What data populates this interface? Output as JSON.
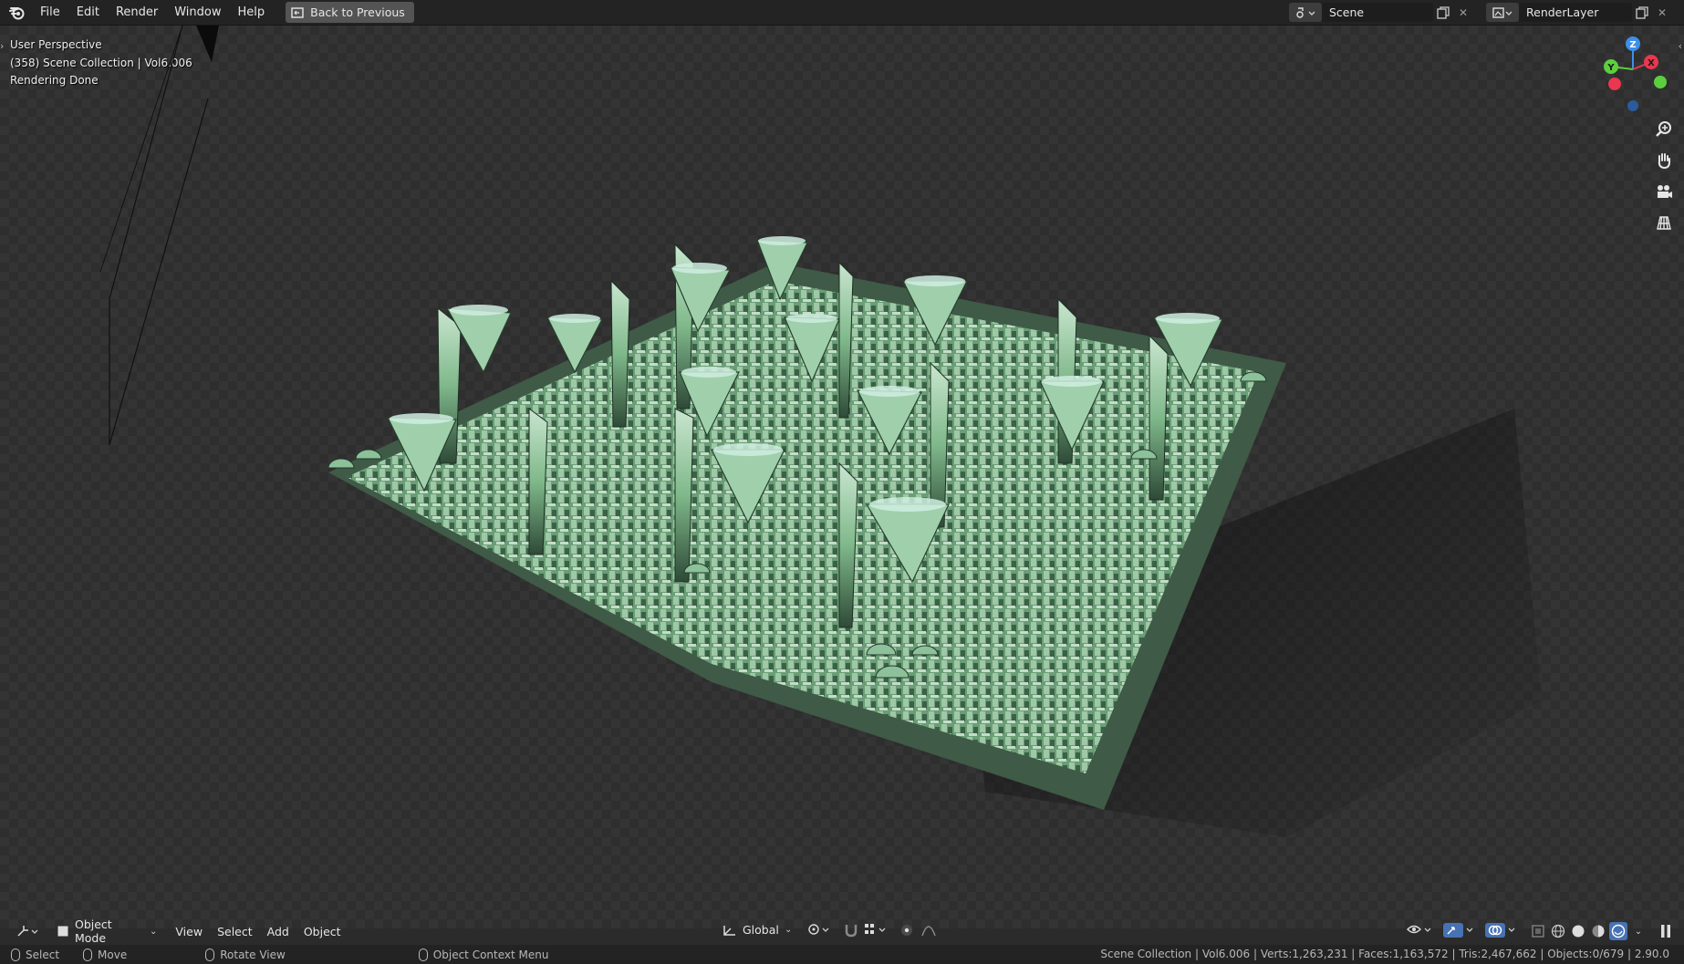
{
  "topbar": {
    "menus": [
      "File",
      "Edit",
      "Render",
      "Window",
      "Help"
    ],
    "back_button": "Back to Previous",
    "scene_label": "Scene",
    "render_layer_label": "RenderLayer"
  },
  "viewport": {
    "overlay": {
      "perspective": "User Perspective",
      "collection": "(358) Scene Collection | Vol6.006",
      "render_status": "Rendering Done"
    },
    "gizmo_axes": [
      "Z",
      "Y",
      "X"
    ],
    "nav_tools": [
      "zoom-icon",
      "hand-pan-icon",
      "camera-view-icon",
      "grid-ortho-icon"
    ],
    "accent_colors": {
      "x_axis": "#e8374f",
      "y_axis": "#5ccf3e",
      "z_axis": "#3d8fea",
      "building": "#7fb88a"
    }
  },
  "bottom_header": {
    "mode": "Object Mode",
    "menus": [
      "View",
      "Select",
      "Add",
      "Object"
    ],
    "transform_orientation": "Global"
  },
  "statusbar": {
    "keys": [
      {
        "label": "Select"
      },
      {
        "label": "Move"
      },
      {
        "label": "Rotate View"
      },
      {
        "label": "Object Context Menu"
      }
    ],
    "stats": "Scene Collection | Vol6.006 | Verts:1,263,231 | Faces:1,163,572 | Tris:2,467,662 | Objects:0/679 | 2.90.0"
  }
}
